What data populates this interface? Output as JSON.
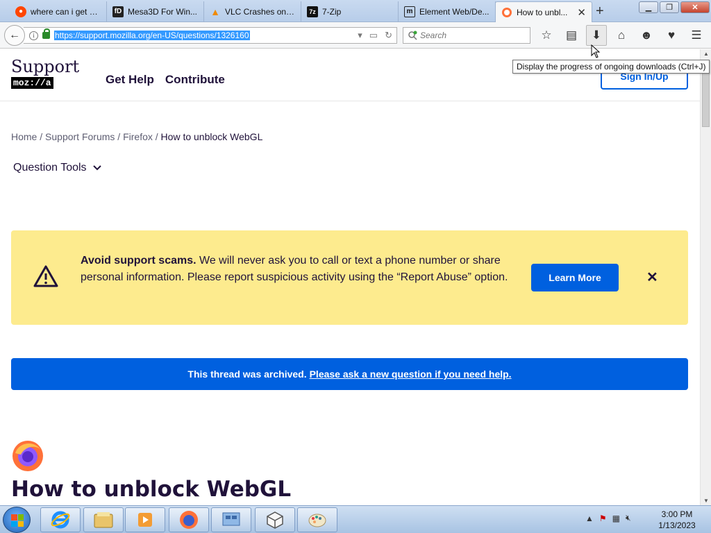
{
  "tabs": [
    {
      "label": "where can i get a...",
      "icon": "reddit-icon",
      "active": false
    },
    {
      "label": "Mesa3D For Win...",
      "icon": "fdossena-icon",
      "active": false
    },
    {
      "label": "VLC Crashes on ...",
      "icon": "vlc-icon",
      "active": false
    },
    {
      "label": "7-Zip",
      "icon": "7zip-icon",
      "active": false
    },
    {
      "label": "Element Web/De...",
      "icon": "matrix-icon",
      "active": false
    },
    {
      "label": "How to unbl...",
      "icon": "firefox-icon",
      "active": true
    }
  ],
  "navbar": {
    "url": "https://support.mozilla.org/en-US/questions/1326160",
    "search_placeholder": "Search"
  },
  "tooltip": "Display the progress of ongoing downloads (Ctrl+J)",
  "header": {
    "logo_word": "Support",
    "logo_sub": "moz://a",
    "nav": [
      "Get Help",
      "Contribute"
    ],
    "signin": "Sign In/Up"
  },
  "breadcrumb": {
    "home": "Home",
    "forums": "Support Forums",
    "product": "Firefox",
    "current": "How to unblock WebGL",
    "sep": "/"
  },
  "question_tools": "Question Tools",
  "scam_banner": {
    "bold": "Avoid support scams.",
    "text": "We will never ask you to call or text a phone number or share personal information. Please report suspicious activity using the “Report Abuse” option.",
    "button": "Learn More",
    "bg": "#fdeb8e"
  },
  "archived_banner": {
    "text": "This thread was archived.",
    "link": "Please ask a new question if you need help.",
    "bg": "#0060df"
  },
  "question_title": "How to unblock WebGL",
  "clock": {
    "time": "3:00 PM",
    "date": "1/13/2023"
  },
  "colors": {
    "accent": "#0060df",
    "text": "#20123a"
  }
}
